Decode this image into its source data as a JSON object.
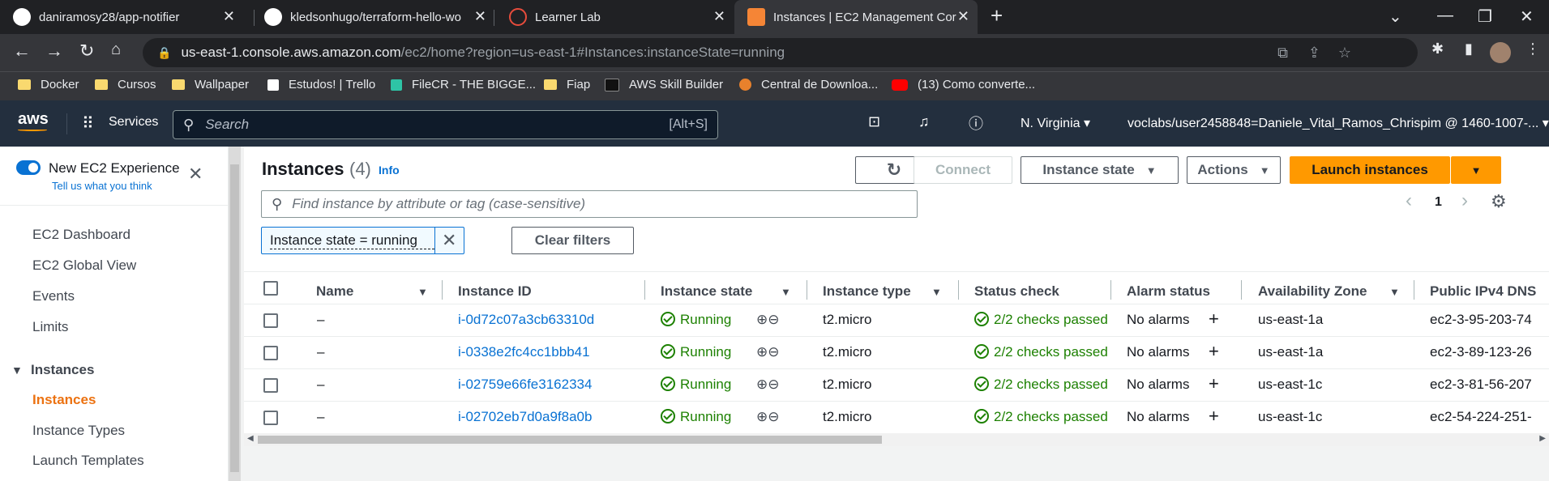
{
  "browser": {
    "tabs": [
      {
        "title": "daniramosy28/app-notifier",
        "active": false
      },
      {
        "title": "kledsonhugo/terraform-hello-wo",
        "active": false
      },
      {
        "title": "Learner Lab",
        "active": false
      },
      {
        "title": "Instances | EC2 Management Cor",
        "active": true
      }
    ],
    "new_tab": "+",
    "url_host": "us-east-1.console.aws.amazon.com",
    "url_path": "/ec2/home?region=us-east-1#Instances:instanceState=running",
    "bookmarks": [
      "Docker",
      "Cursos",
      "Wallpaper",
      "Estudos! | Trello",
      "FileCR - THE BIGGE...",
      "Fiap",
      "AWS Skill Builder",
      "Central de Downloa...",
      "(13) Como converte..."
    ]
  },
  "aws_nav": {
    "logo": "aws",
    "services": "Services",
    "search_placeholder": "Search",
    "search_shortcut": "[Alt+S]",
    "region": "N. Virginia",
    "account": "voclabs/user2458848=Daniele_Vital_Ramos_Chrispim @ 1460-1007-..."
  },
  "sidebar": {
    "new_experience": "New EC2 Experience",
    "tell_us": "Tell us what you think",
    "items": [
      "EC2 Dashboard",
      "EC2 Global View",
      "Events",
      "Limits"
    ],
    "section": "Instances",
    "section_items": [
      "Instances",
      "Instance Types",
      "Launch Templates"
    ]
  },
  "header": {
    "title": "Instances",
    "count": "(4)",
    "info": "Info",
    "connect": "Connect",
    "instance_state": "Instance state",
    "actions": "Actions",
    "launch": "Launch instances",
    "filter_placeholder": "Find instance by attribute or tag (case-sensitive)",
    "page": "1",
    "filter_token": "Instance state = running",
    "clear_filters": "Clear filters"
  },
  "table": {
    "columns": [
      "Name",
      "Instance ID",
      "Instance state",
      "Instance type",
      "Status check",
      "Alarm status",
      "Availability Zone",
      "Public IPv4 DNS"
    ],
    "rows": [
      {
        "name": "–",
        "id": "i-0d72c07a3cb63310d",
        "state": "Running",
        "type": "t2.micro",
        "status": "2/2 checks passed",
        "alarm": "No alarms",
        "az": "us-east-1a",
        "dns": "ec2-3-95-203-74"
      },
      {
        "name": "–",
        "id": "i-0338e2fc4cc1bbb41",
        "state": "Running",
        "type": "t2.micro",
        "status": "2/2 checks passed",
        "alarm": "No alarms",
        "az": "us-east-1a",
        "dns": "ec2-3-89-123-26"
      },
      {
        "name": "–",
        "id": "i-02759e66fe3162334",
        "state": "Running",
        "type": "t2.micro",
        "status": "2/2 checks passed",
        "alarm": "No alarms",
        "az": "us-east-1c",
        "dns": "ec2-3-81-56-207"
      },
      {
        "name": "–",
        "id": "i-02702eb7d0a9f8a0b",
        "state": "Running",
        "type": "t2.micro",
        "status": "2/2 checks passed",
        "alarm": "No alarms",
        "az": "us-east-1c",
        "dns": "ec2-54-224-251-"
      }
    ]
  },
  "colors": {
    "aws_nav": "#232f3e",
    "accent_orange": "#ff9900",
    "link": "#0972d3",
    "success": "#1d8102"
  }
}
